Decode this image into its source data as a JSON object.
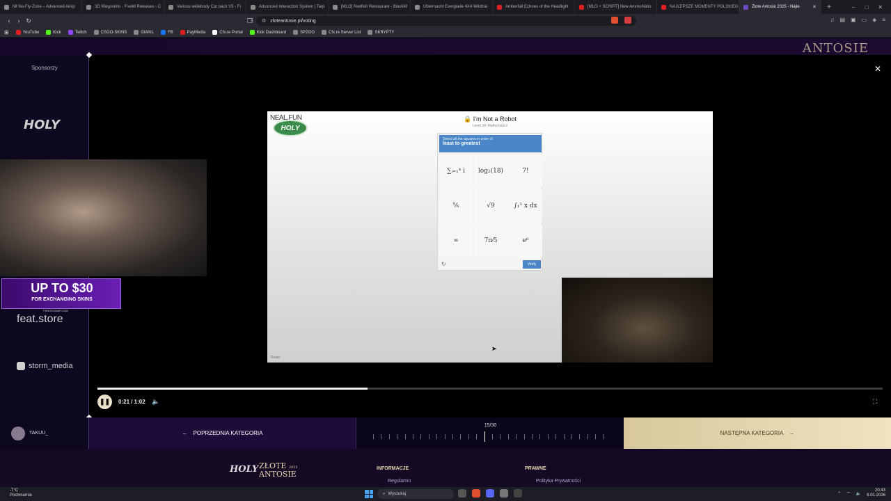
{
  "browser": {
    "tabs": [
      {
        "label": "MI No-Fly-Zone – Advanced Airsp",
        "color": "#8a8a8a"
      },
      {
        "label": "3D Waypoints - FiveM Releases - C",
        "color": "#8a8a8a"
      },
      {
        "label": "Various widebody Car pack V5 - Fi",
        "color": "#8a8a8a"
      },
      {
        "label": "Advanced Interaction System | Tarp",
        "color": "#8a8a8a"
      },
      {
        "label": "[MLO] Redfish Restaurant - BlackW",
        "color": "#8a8a8a"
      },
      {
        "label": "Ubermacht Everglade 4X4 Wildtrai",
        "color": "#8a8a8a"
      },
      {
        "label": "Amberfall Echoes of the Headlight",
        "color": "#e02020"
      },
      {
        "label": "[MLO + SCRIPT] New AmmuNatio",
        "color": "#e02020"
      },
      {
        "label": "NAJLEPSZE MOMENTY POLSKIEGO",
        "color": "#e02020"
      },
      {
        "label": "Złote Antosie 2025 - Najle",
        "color": "#6a4bc2",
        "active": true
      }
    ],
    "new_tab": "+",
    "url": "zloteantosie.pl/voting",
    "bookmarks": [
      "YouTube",
      "Kick",
      "Twitch",
      "CSGO-SKINS",
      "GMAIL",
      "FB",
      "PayMedia",
      "Cfx.re Portal",
      "Kick Dashboard",
      "SPZOO",
      "Cfx.re Server List",
      "SKRYPTY"
    ]
  },
  "page": {
    "top_logo": "ANTOSIE",
    "sponsors_title": "Sponsorzy",
    "sponsors": {
      "holy": "HOLY",
      "feat": "feat.store",
      "storm": "storm_media"
    },
    "close": "✕"
  },
  "video": {
    "neal_fun": "NEAL.FUN",
    "holy_logo": "HOLY",
    "robot_title": "I'm Not a Robot",
    "robot_level": "Level 34: Mathematics",
    "captcha_instruction": "Select all the squares in order of",
    "captcha_task": "least to greatest",
    "cells": [
      "∑ᵢ₌₁⁴ i",
      "log₂(18)",
      "7!",
      "⅚",
      "√9",
      "∫₁⁵ x dx",
      "∞",
      "7π⁄5",
      "e⁶"
    ],
    "verify": "Verify",
    "reset": "Reset",
    "promo_big": "UP TO $30",
    "promo_small": "FOR EXCHANGING SKINS",
    "promo_source": "PIRATESWAP.COM"
  },
  "player": {
    "time": "0:21 / 1:02",
    "progress": 0.344
  },
  "categories": {
    "user": "TAKUU_",
    "prev": "POPRZEDNIA KATEGORIA",
    "counter": "15/30",
    "current": 15,
    "total": 30,
    "next": "NASTĘPNA KATEGORIA"
  },
  "footer": {
    "logo_holy": "HOLY",
    "logo_zlote": "ZŁOTE",
    "logo_antosie": "ANTOSIE",
    "logo_year": "2025",
    "info_heading": "INFORMACJE",
    "info_link": "Regulamin",
    "legal_heading": "PRAWNE",
    "legal_link": "Polityka Prywatności"
  },
  "taskbar": {
    "temp": "-7°C",
    "weather": "Pochmurnie",
    "search": "Wyszukaj",
    "time": "20:43",
    "date": "6.01.2026"
  }
}
